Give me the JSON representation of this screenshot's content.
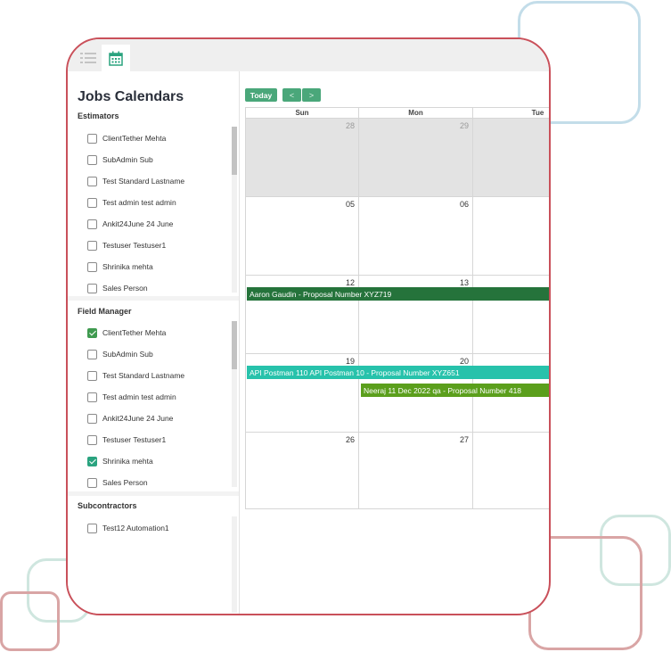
{
  "page_title": "Jobs Calendars",
  "colors": {
    "accent": "#4aa77a",
    "frame_border": "#c9505a",
    "event_dark_green": "#25733b",
    "event_teal": "#27c2ab",
    "event_green": "#5b9f1c"
  },
  "tabs": [
    {
      "icon": "list-icon"
    },
    {
      "icon": "calendar-icon"
    }
  ],
  "sections": {
    "estimators": {
      "title": "Estimators",
      "items": [
        {
          "label": "ClientTether Mehta",
          "checked": false
        },
        {
          "label": "SubAdmin Sub",
          "checked": false
        },
        {
          "label": "Test Standard Lastname",
          "checked": false
        },
        {
          "label": "Test admin test admin",
          "checked": false
        },
        {
          "label": "Ankit24June 24 June",
          "checked": false
        },
        {
          "label": "Testuser Testuser1",
          "checked": false
        },
        {
          "label": "Shrinika mehta",
          "checked": false
        },
        {
          "label": "Sales Person",
          "checked": false
        }
      ]
    },
    "field_manager": {
      "title": "Field Manager",
      "items": [
        {
          "label": "ClientTether Mehta",
          "checked": true
        },
        {
          "label": "SubAdmin Sub",
          "checked": false
        },
        {
          "label": "Test Standard Lastname",
          "checked": false
        },
        {
          "label": "Test admin test admin",
          "checked": false
        },
        {
          "label": "Ankit24June 24 June",
          "checked": false
        },
        {
          "label": "Testuser Testuser1",
          "checked": false
        },
        {
          "label": "Shrinika mehta",
          "checked": true
        },
        {
          "label": "Sales Person",
          "checked": false
        }
      ]
    },
    "subcontractors": {
      "title": "Subcontractors",
      "items": [
        {
          "label": "Test12 Automation1",
          "checked": false
        }
      ]
    }
  },
  "toolbar": {
    "today_label": "Today",
    "prev_label": "<",
    "next_label": ">"
  },
  "calendar": {
    "days_of_week": [
      "Sun",
      "Mon",
      "Tue"
    ],
    "weeks": [
      [
        "28",
        "29",
        ""
      ],
      [
        "05",
        "06",
        ""
      ],
      [
        "12",
        "13",
        ""
      ],
      [
        "19",
        "20",
        ""
      ],
      [
        "26",
        "27",
        ""
      ]
    ],
    "events": [
      "Aaron Gaudin - Proposal Number XYZ719",
      "API Postman 110 API Postman 10 - Proposal Number XYZ651",
      "Neeraj 11 Dec 2022 qa - Proposal Number 418"
    ]
  }
}
